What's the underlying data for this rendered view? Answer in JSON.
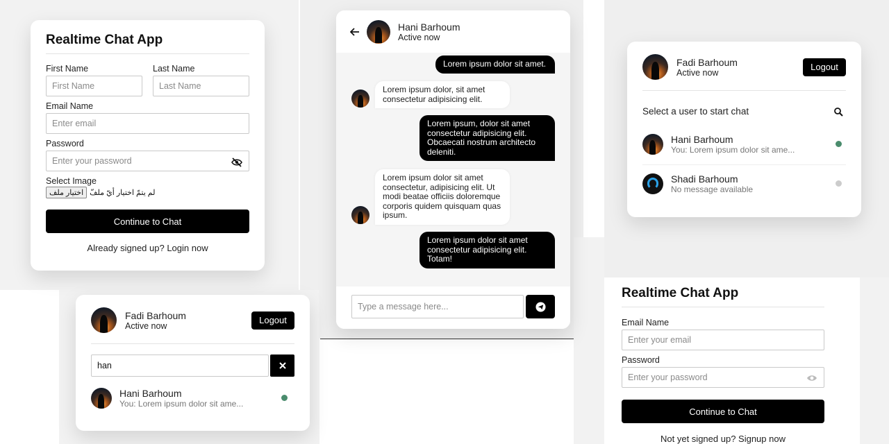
{
  "signup": {
    "title": "Realtime Chat App",
    "first_name_label": "First Name",
    "first_name_placeholder": "First Name",
    "last_name_label": "Last Name",
    "last_name_placeholder": "Last Name",
    "email_label": "Email Name",
    "email_placeholder": "Enter email",
    "password_label": "Password",
    "password_placeholder": "Enter your password",
    "image_label": "Select Image",
    "file_button": "اختيار ملف",
    "file_status": "لم يتمّ اختيار أيّ ملفّ",
    "submit_label": "Continue to Chat",
    "footer_text": "Already signed up? Login now"
  },
  "chat": {
    "contact_name": "Hani Barhoum",
    "contact_status": "Active now",
    "messages": [
      {
        "dir": "out",
        "text": "Lorem ipsum dolor sit amet."
      },
      {
        "dir": "in",
        "text": "Lorem ipsum dolor, sit amet consectetur adipisicing elit."
      },
      {
        "dir": "out",
        "text": "Lorem ipsum, dolor sit amet consectetur adipisicing elit. Obcaecati nostrum architecto deleniti."
      },
      {
        "dir": "in",
        "text": "Lorem ipsum dolor sit amet consectetur, adipisicing elit. Ut modi beatae officiis doloremque corporis quidem quisquam quas ipsum."
      },
      {
        "dir": "out",
        "text": "Lorem ipsum dolor sit amet consectetur adipisicing elit. Totam!"
      }
    ],
    "input_placeholder": "Type a message here..."
  },
  "users": {
    "me_name": "Fadi Barhoum",
    "me_status": "Active now",
    "logout_label": "Logout",
    "search_prompt": "Select a user to start chat",
    "list": [
      {
        "name": "Hani Barhoum",
        "preview": "You: Lorem ipsum dolor sit ame...",
        "status_color": "#4a8c6d"
      },
      {
        "name": "Shadi Barhoum",
        "preview": "No message available",
        "status_color": "#cccccc"
      }
    ]
  },
  "search": {
    "me_name": "Fadi Barhoum",
    "me_status": "Active now",
    "logout_label": "Logout",
    "query": "han",
    "clear_icon": "close-icon",
    "result": {
      "name": "Hani Barhoum",
      "preview": "You: Lorem ipsum dolor sit ame...",
      "status_color": "#4a8c6d"
    }
  },
  "login": {
    "title": "Realtime Chat App",
    "email_label": "Email Name",
    "email_placeholder": "Enter your email",
    "password_label": "Password",
    "password_placeholder": "Enter your password",
    "submit_label": "Continue to Chat",
    "footer_text": "Not yet signed up? Signup now"
  }
}
